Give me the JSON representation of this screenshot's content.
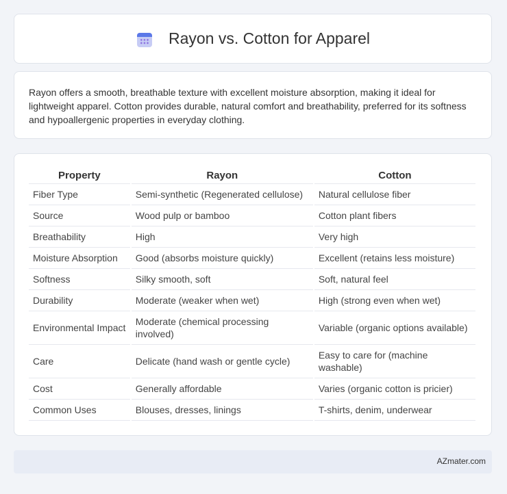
{
  "header": {
    "title": "Rayon vs. Cotton for Apparel",
    "icon": "calendar-icon"
  },
  "intro": "Rayon offers a smooth, breathable texture with excellent moisture absorption, making it ideal for lightweight apparel. Cotton provides durable, natural comfort and breathability, preferred for its softness and hypoallergenic properties in everyday clothing.",
  "table": {
    "headers": [
      "Property",
      "Rayon",
      "Cotton"
    ],
    "rows": [
      [
        "Fiber Type",
        "Semi-synthetic (Regenerated cellulose)",
        "Natural cellulose fiber"
      ],
      [
        "Source",
        "Wood pulp or bamboo",
        "Cotton plant fibers"
      ],
      [
        "Breathability",
        "High",
        "Very high"
      ],
      [
        "Moisture Absorption",
        "Good (absorbs moisture quickly)",
        "Excellent (retains less moisture)"
      ],
      [
        "Softness",
        "Silky smooth, soft",
        "Soft, natural feel"
      ],
      [
        "Durability",
        "Moderate (weaker when wet)",
        "High (strong even when wet)"
      ],
      [
        "Environmental Impact",
        "Moderate (chemical processing involved)",
        "Variable (organic options available)"
      ],
      [
        "Care",
        "Delicate (hand wash or gentle cycle)",
        "Easy to care for (machine washable)"
      ],
      [
        "Cost",
        "Generally affordable",
        "Varies (organic cotton is pricier)"
      ],
      [
        "Common Uses",
        "Blouses, dresses, linings",
        "T-shirts, denim, underwear"
      ]
    ]
  },
  "footer": {
    "site": "AZmater.com"
  }
}
